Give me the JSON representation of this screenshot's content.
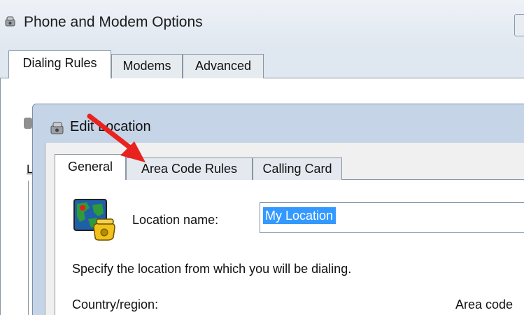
{
  "outer_dialog": {
    "title": "Phone and Modem Options",
    "icon": "phone-modem-icon",
    "tabs": [
      {
        "label": "Dialing Rules",
        "selected": true
      },
      {
        "label": "Modems",
        "selected": false
      },
      {
        "label": "Advanced",
        "selected": false
      }
    ],
    "partial_label": "L"
  },
  "edit_location": {
    "title": "Edit Location",
    "icon": "phone-modem-icon",
    "tabs": [
      {
        "label": "General",
        "selected": true
      },
      {
        "label": "Area Code Rules",
        "selected": false
      },
      {
        "label": "Calling Card",
        "selected": false
      }
    ],
    "location_name_label": "Location name:",
    "location_name_value": "My Location",
    "location_icon": "globe-telephone-icon",
    "instruction": "Specify the location from which you will be dialing.",
    "country_label": "Country/region:",
    "area_code_label": "Area code"
  },
  "annotation": {
    "icon": "red-arrow-icon",
    "color": "#e8231f"
  }
}
